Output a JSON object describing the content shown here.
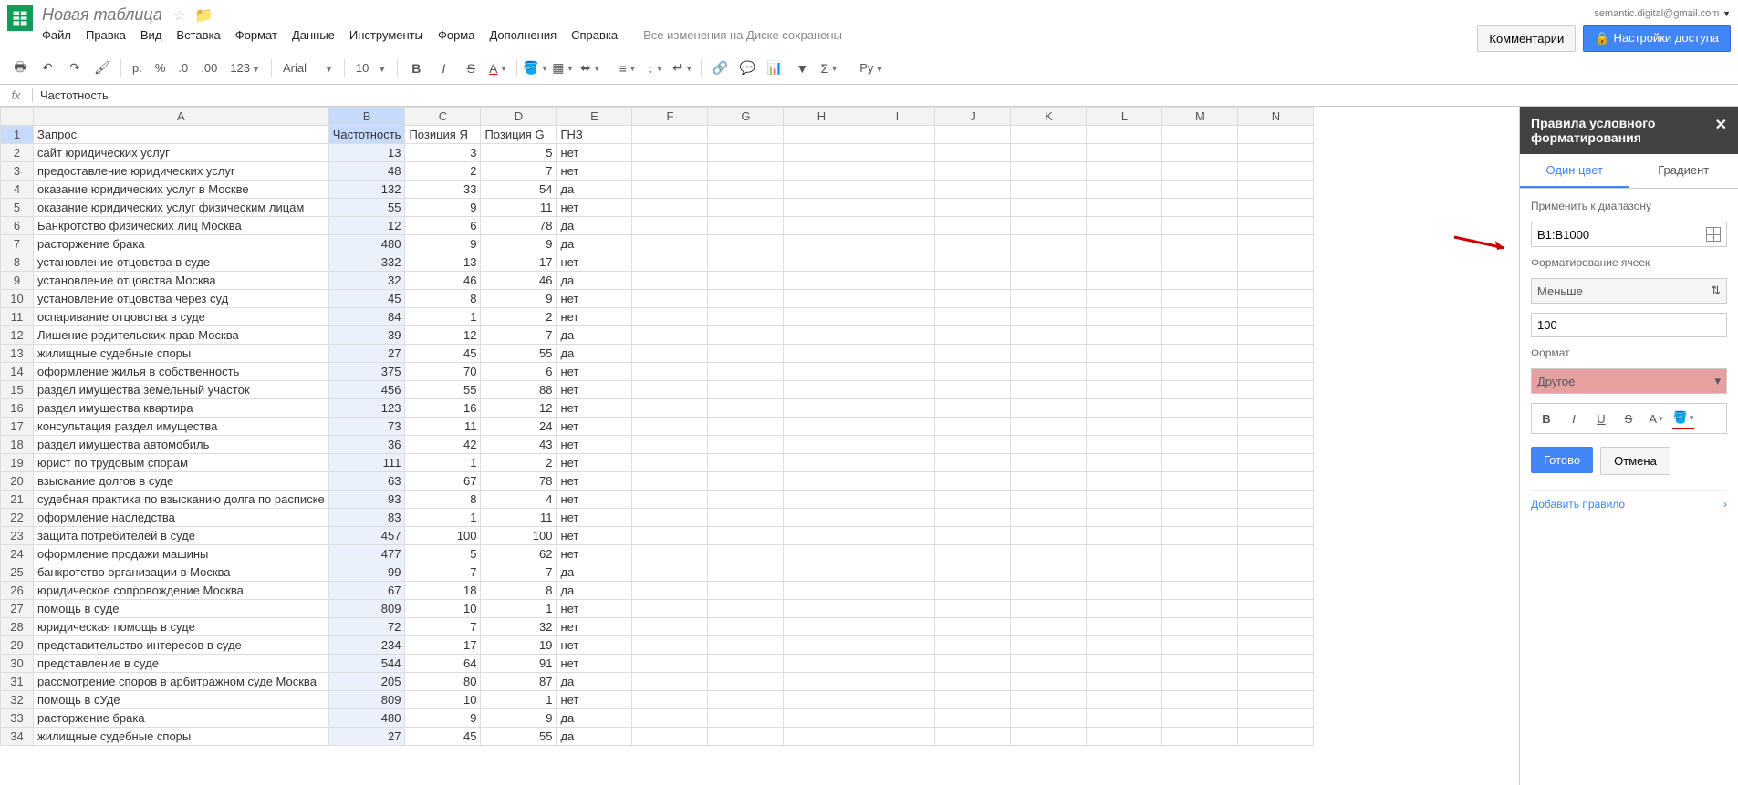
{
  "doc": {
    "title": "Новая таблица"
  },
  "user": {
    "email": "semantic.digital@gmail.com"
  },
  "header_buttons": {
    "comments": "Комментарии",
    "share": "Настройки доступа"
  },
  "menu": [
    "Файл",
    "Правка",
    "Вид",
    "Вставка",
    "Формат",
    "Данные",
    "Инструменты",
    "Форма",
    "Дополнения",
    "Справка"
  ],
  "save_status": "Все изменения на Диске сохранены",
  "toolbar": {
    "currency": "р.",
    "percent": "%",
    "dec_dec": ".0",
    "dec_inc": ".00",
    "more_formats": "123",
    "font": "Arial",
    "font_size": "10"
  },
  "formula": {
    "fx": "fx",
    "value": "Частотность"
  },
  "columns": [
    "A",
    "B",
    "C",
    "D",
    "E",
    "F",
    "G",
    "H",
    "I",
    "J",
    "K",
    "L",
    "M",
    "N"
  ],
  "headers": {
    "A": "Запрос",
    "B": "Частотность",
    "C": "Позиция Я",
    "D": "Позиция G",
    "E": "ГНЗ"
  },
  "selected_col": "B",
  "selected_row": 1,
  "highlight_threshold": 100,
  "rows": [
    {
      "A": "сайт юридических услуг",
      "B": 13,
      "C": 3,
      "D": 5,
      "E": "нет"
    },
    {
      "A": "предоставление юридических услуг",
      "B": 48,
      "C": 2,
      "D": 7,
      "E": "нет"
    },
    {
      "A": "оказание юридических услуг в Москве",
      "B": 132,
      "C": 33,
      "D": 54,
      "E": "да"
    },
    {
      "A": "оказание юридических услуг физическим лицам",
      "B": 55,
      "C": 9,
      "D": 11,
      "E": "нет"
    },
    {
      "A": "Банкротство физических лиц Москва",
      "B": 12,
      "C": 6,
      "D": 78,
      "E": "да"
    },
    {
      "A": "расторжение брака",
      "B": 480,
      "C": 9,
      "D": 9,
      "E": "да"
    },
    {
      "A": "установление отцовства в суде",
      "B": 332,
      "C": 13,
      "D": 17,
      "E": "нет"
    },
    {
      "A": "установление отцовства Москва",
      "B": 32,
      "C": 46,
      "D": 46,
      "E": "да"
    },
    {
      "A": "установление отцовства через суд",
      "B": 45,
      "C": 8,
      "D": 9,
      "E": "нет"
    },
    {
      "A": "оспаривание отцовства в суде",
      "B": 84,
      "C": 1,
      "D": 2,
      "E": "нет"
    },
    {
      "A": "Лишение родительских прав Москва",
      "B": 39,
      "C": 12,
      "D": 7,
      "E": "да"
    },
    {
      "A": "жилищные судебные споры",
      "B": 27,
      "C": 45,
      "D": 55,
      "E": "да"
    },
    {
      "A": "оформление жилья в собственность",
      "B": 375,
      "C": 70,
      "D": 6,
      "E": "нет"
    },
    {
      "A": "раздел имущества земельный участок",
      "B": 456,
      "C": 55,
      "D": 88,
      "E": "нет"
    },
    {
      "A": "раздел имущества квартира",
      "B": 123,
      "C": 16,
      "D": 12,
      "E": "нет"
    },
    {
      "A": "консультация раздел имущества",
      "B": 73,
      "C": 11,
      "D": 24,
      "E": "нет"
    },
    {
      "A": "раздел имущества автомобиль",
      "B": 36,
      "C": 42,
      "D": 43,
      "E": "нет"
    },
    {
      "A": "юрист по трудовым спорам",
      "B": 111,
      "C": 1,
      "D": 2,
      "E": "нет"
    },
    {
      "A": "взыскание долгов в суде",
      "B": 63,
      "C": 67,
      "D": 78,
      "E": "нет"
    },
    {
      "A": "судебная практика по взысканию долга по расписке",
      "B": 93,
      "C": 8,
      "D": 4,
      "E": "нет"
    },
    {
      "A": "оформление наследства",
      "B": 83,
      "C": 1,
      "D": 11,
      "E": "нет"
    },
    {
      "A": "защита потребителей в суде",
      "B": 457,
      "C": 100,
      "D": 100,
      "E": "нет"
    },
    {
      "A": "оформление продажи машины",
      "B": 477,
      "C": 5,
      "D": 62,
      "E": "нет"
    },
    {
      "A": "банкротство организации в Москва",
      "B": 99,
      "C": 7,
      "D": 7,
      "E": "да"
    },
    {
      "A": "юридическое сопровождение Москва",
      "B": 67,
      "C": 18,
      "D": 8,
      "E": "да"
    },
    {
      "A": "помощь в суде",
      "B": 809,
      "C": 10,
      "D": 1,
      "E": "нет"
    },
    {
      "A": "юридическая помощь в суде",
      "B": 72,
      "C": 7,
      "D": 32,
      "E": "нет"
    },
    {
      "A": "представительство интересов в суде",
      "B": 234,
      "C": 17,
      "D": 19,
      "E": "нет"
    },
    {
      "A": "представление в суде",
      "B": 544,
      "C": 64,
      "D": 91,
      "E": "нет"
    },
    {
      "A": "рассмотрение споров в арбитражном суде Москва",
      "B": 205,
      "C": 80,
      "D": 87,
      "E": "да"
    },
    {
      "A": "помощь в сУде",
      "B": 809,
      "C": 10,
      "D": 1,
      "E": "нет"
    },
    {
      "A": "расторжение брака",
      "B": 480,
      "C": 9,
      "D": 9,
      "E": "да"
    },
    {
      "A": "жилищные судебные споры",
      "B": 27,
      "C": 45,
      "D": 55,
      "E": "да"
    }
  ],
  "panel": {
    "title": "Правила условного форматирования",
    "tab_single": "Один цвет",
    "tab_gradient": "Градиент",
    "range_label": "Применить к диапазону",
    "range_value": "B1:B1000",
    "format_if_label": "Форматирование ячеек",
    "condition": "Меньше",
    "condition_value": "100",
    "format_label": "Формат",
    "format_style": "Другое",
    "done": "Готово",
    "cancel": "Отмена",
    "add_rule": "Добавить правило"
  }
}
